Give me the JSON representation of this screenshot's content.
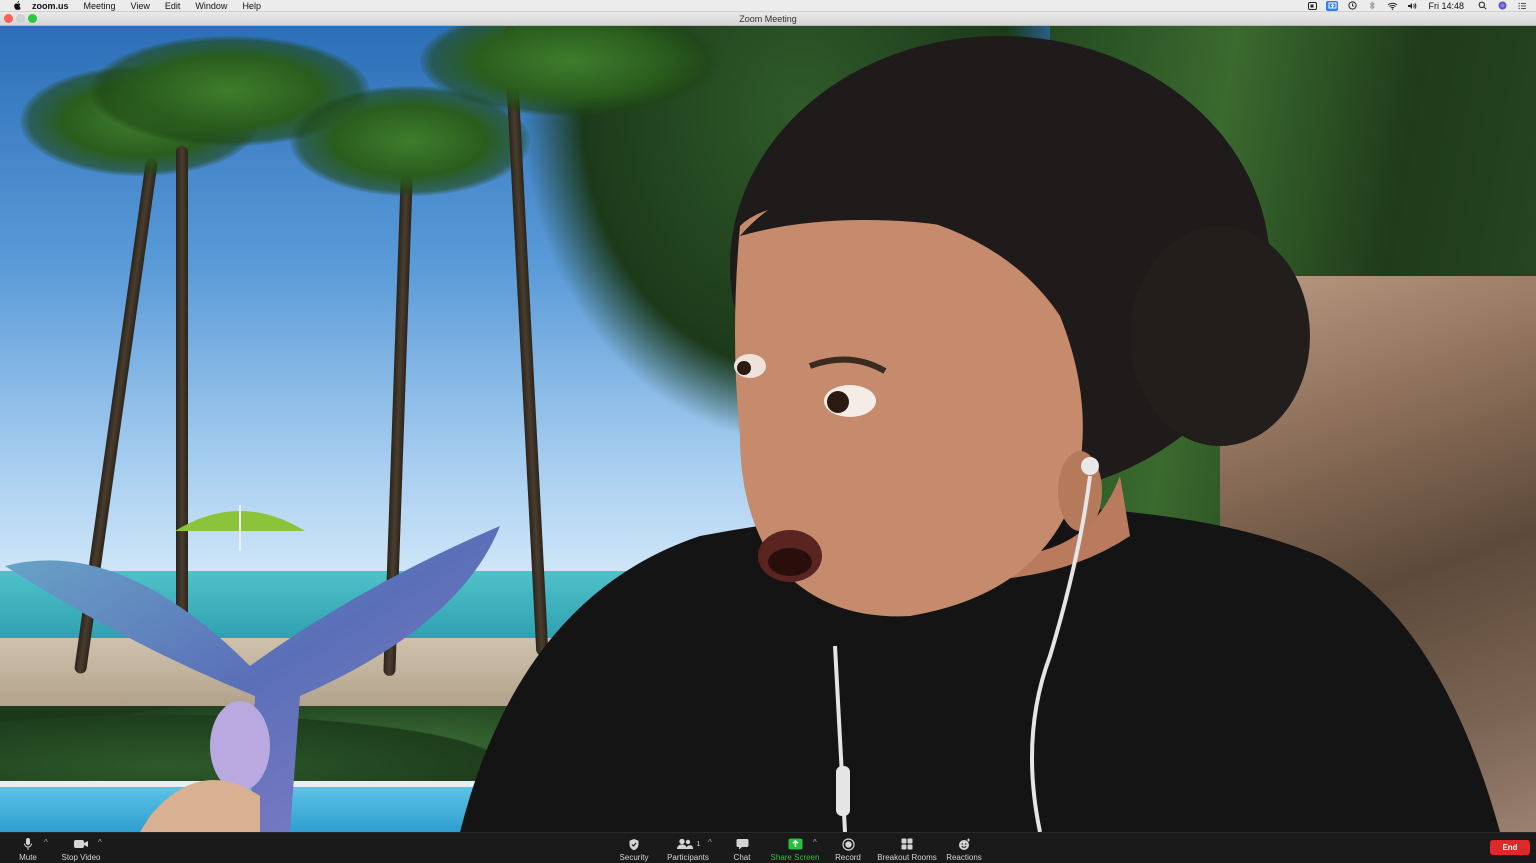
{
  "menubar": {
    "app_name": "zoom.us",
    "items": [
      "Meeting",
      "View",
      "Edit",
      "Window",
      "Help"
    ],
    "clock": "Fri 14:48"
  },
  "window": {
    "title": "Zoom Meeting"
  },
  "toolbar": {
    "mute_label": "Mute",
    "stop_video_label": "Stop Video",
    "security_label": "Security",
    "participants_label": "Participants",
    "participants_count": "1",
    "chat_label": "Chat",
    "share_screen_label": "Share Screen",
    "record_label": "Record",
    "breakout_rooms_label": "Breakout Rooms",
    "reactions_label": "Reactions",
    "end_label": "End"
  },
  "colors": {
    "share_accent": "#27c23d",
    "end_button": "#e02828",
    "toolbar_bg": "#1a1a1a"
  },
  "icons": {
    "menubar_left": "apple-logo-icon",
    "menubar_right": [
      "zoom-status-icon",
      "screen-share-status-icon",
      "time-machine-icon",
      "bluetooth-icon",
      "wifi-icon",
      "volume-icon",
      "spotlight-search-icon",
      "siri-icon",
      "notification-center-icon"
    ],
    "toolbar": [
      "microphone-icon",
      "video-camera-icon",
      "shield-icon",
      "participants-icon",
      "chat-bubble-icon",
      "share-screen-arrow-icon",
      "record-circle-icon",
      "breakout-rooms-grid-icon",
      "reactions-emoji-icon"
    ]
  }
}
